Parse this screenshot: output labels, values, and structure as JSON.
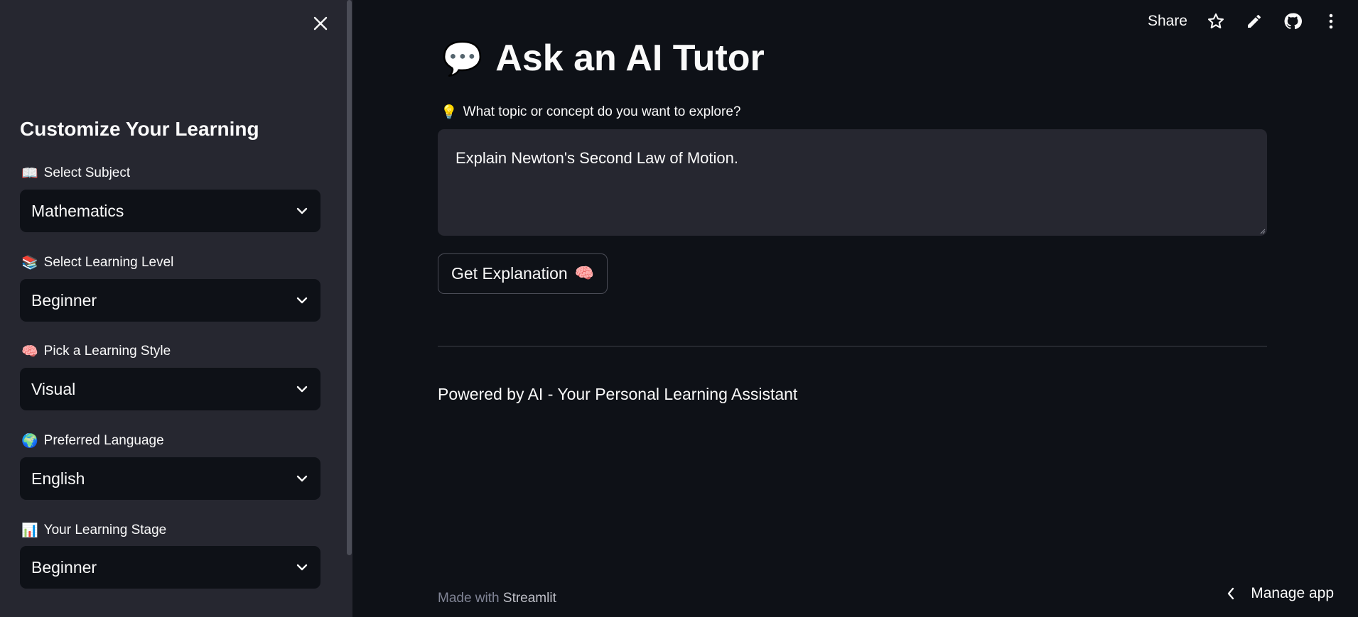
{
  "sidebar": {
    "close_icon": "close-icon",
    "title": "Customize Your Learning",
    "fields": [
      {
        "icon": "📖",
        "label": "Select Subject",
        "value": "Mathematics"
      },
      {
        "icon": "📚",
        "label": "Select Learning Level",
        "value": "Beginner"
      },
      {
        "icon": "🧠",
        "label": "Pick a Learning Style",
        "value": "Visual"
      },
      {
        "icon": "🌍",
        "label": "Preferred Language",
        "value": "English"
      },
      {
        "icon": "📊",
        "label": "Your Learning Stage",
        "value": "Beginner"
      }
    ]
  },
  "toolbar": {
    "share_label": "Share",
    "icons": [
      "star-icon",
      "pencil-icon",
      "github-icon",
      "more-vertical-icon"
    ]
  },
  "main": {
    "title_icon": "💬",
    "title": "Ask an AI Tutor",
    "prompt_icon": "💡",
    "prompt_label": "What topic or concept do you want to explore?",
    "prompt_value": "Explain Newton's Second Law of Motion.",
    "button_label": "Get Explanation",
    "button_icon": "🧠",
    "footer_note": "Powered by AI - Your Personal Learning Assistant"
  },
  "footer": {
    "made_with": "Made with",
    "brand": "Streamlit",
    "manage_app": "Manage app"
  },
  "colors": {
    "background": "#0e1117",
    "sidebar": "#262730",
    "text": "#fafafa",
    "muted": "#808495"
  }
}
